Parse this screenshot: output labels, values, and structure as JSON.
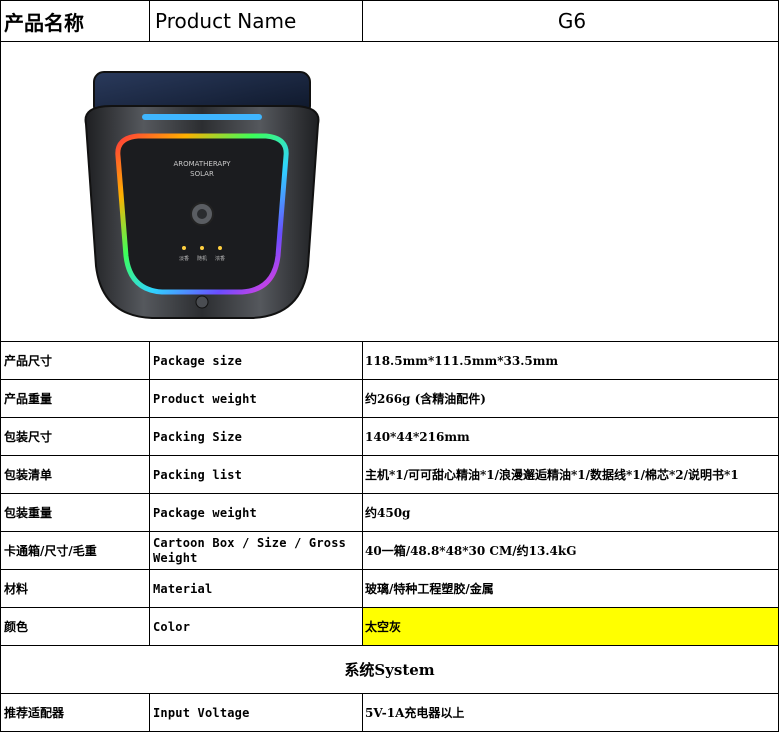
{
  "header": {
    "label_zh": "产品名称",
    "label_en": "Product Name",
    "value": "G6"
  },
  "product_image": {
    "icon": "solar-aromatherapy-device",
    "badge_text": "AROMATHERAPY",
    "badge_sub": "SOLAR",
    "indicator_labels": [
      "淡香",
      "随机",
      "浓香"
    ],
    "colors": {
      "body": "#3a3c40",
      "solar_panel": "#1a2a4a",
      "accent_blue": "#3fb6ff"
    }
  },
  "rows": [
    {
      "zh": "产品尺寸",
      "en": "Package size",
      "value": "118.5mm*111.5mm*33.5mm"
    },
    {
      "zh": "产品重量",
      "en": "Product weight",
      "value": "约266g (含精油配件)"
    },
    {
      "zh": "包装尺寸",
      "en": "Packing Size",
      "value": "140*44*216mm"
    },
    {
      "zh": "包装清单",
      "en": "Packing list",
      "value": "主机*1/可可甜心精油*1/浪漫邂逅精油*1/数据线*1/棉芯*2/说明书*1"
    },
    {
      "zh": "包装重量",
      "en": "Package weight",
      "value": "约450g"
    },
    {
      "zh": "卡通箱/尺寸/毛重",
      "en": "Cartoon Box / Size / Gross Weight",
      "value": "40一箱/48.8*48*30 CM/约13.4kG"
    },
    {
      "zh": "材料",
      "en": "Material",
      "value": "玻璃/特种工程塑胶/金属"
    },
    {
      "zh": "颜色",
      "en": "Color",
      "value": "太空灰",
      "highlight": "#ffff00"
    }
  ],
  "section_title": "系统System",
  "system_rows": [
    {
      "zh": "推荐适配器",
      "en": "Input Voltage",
      "value": "5V-1A充电器以上"
    }
  ]
}
